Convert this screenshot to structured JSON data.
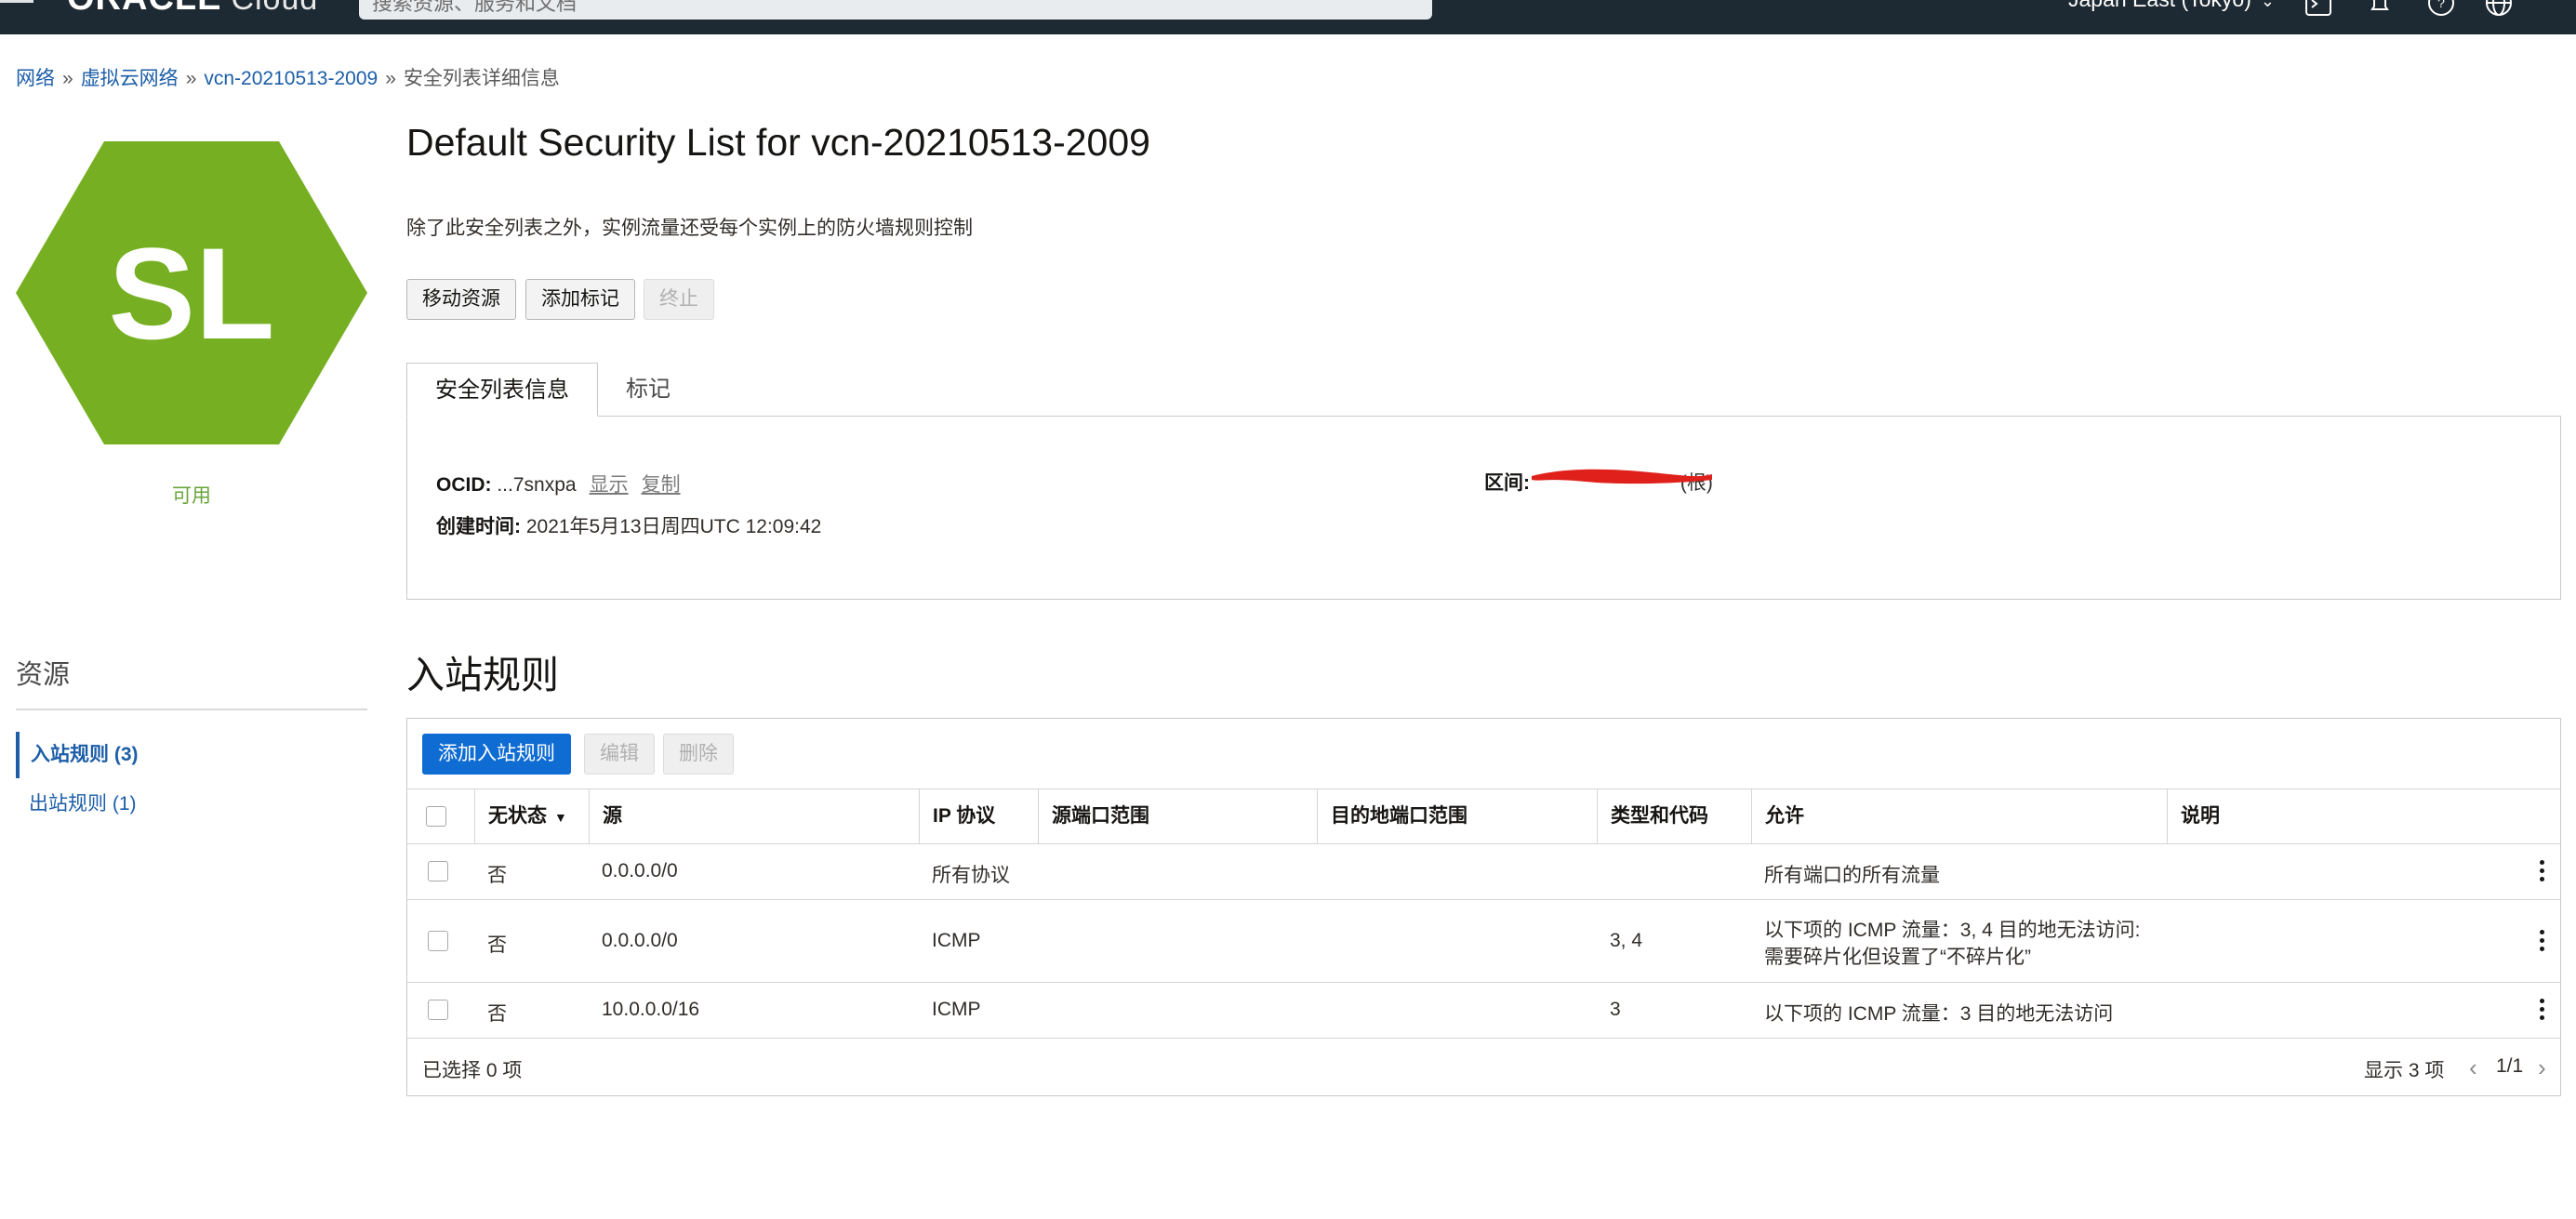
{
  "topbar": {
    "logo": "ORACLE",
    "logo_sub": "Cloud",
    "search_placeholder": "搜索资源、服务和文档",
    "region": "Japan East (Tokyo)"
  },
  "breadcrumb": {
    "items": [
      "网络",
      "虚拟云网络",
      "vcn-20210513-2009"
    ],
    "current": "安全列表详细信息"
  },
  "resource_icon": {
    "initials": "SL",
    "color": "#76b022"
  },
  "status": "可用",
  "resources": {
    "title": "资源",
    "items": [
      {
        "label": "入站规则 (3)",
        "active": true
      },
      {
        "label": "出站规则 (1)",
        "active": false
      }
    ]
  },
  "page": {
    "title": "Default Security List for vcn-20210513-2009",
    "description": "除了此安全列表之外，实例流量还受每个实例上的防火墙规则控制",
    "actions": {
      "move": "移动资源",
      "add_tags": "添加标记",
      "terminate": "终止"
    }
  },
  "tabs": {
    "info": "安全列表信息",
    "tags": "标记"
  },
  "info": {
    "ocid_label": "OCID:",
    "ocid_value": "...7snxpa",
    "show": "显示",
    "copy": "复制",
    "created_label": "创建时间:",
    "created_value": "2021年5月13日周四UTC 12:09:42",
    "compartment_label": "区间:",
    "compartment_suffix": "(根)"
  },
  "ingress": {
    "title": "入站规则",
    "buttons": {
      "add": "添加入站规则",
      "edit": "编辑",
      "delete": "删除"
    },
    "columns": [
      "无状态",
      "源",
      "IP 协议",
      "源端口范围",
      "目的地端口范围",
      "类型和代码",
      "允许",
      "说明"
    ],
    "rows": [
      {
        "stateless": "否",
        "source": "0.0.0.0/0",
        "protocol": "所有协议",
        "src_port": "",
        "dst_port": "",
        "type_code": "",
        "allows": "所有端口的所有流量",
        "allows2": "",
        "description": ""
      },
      {
        "stateless": "否",
        "source": "0.0.0.0/0",
        "protocol": "ICMP",
        "src_port": "",
        "dst_port": "",
        "type_code": "3, 4",
        "allows": "以下项的 ICMP 流量：3, 4 目的地无法访问:",
        "allows2": "需要碎片化但设置了“不碎片化”",
        "description": ""
      },
      {
        "stateless": "否",
        "source": "10.0.0.0/16",
        "protocol": "ICMP",
        "src_port": "",
        "dst_port": "",
        "type_code": "3",
        "allows": "以下项的 ICMP 流量：3 目的地无法访问",
        "allows2": "",
        "description": ""
      }
    ],
    "selected": "已选择 0 项",
    "showing": "显示 3 项",
    "page": "1/1"
  }
}
